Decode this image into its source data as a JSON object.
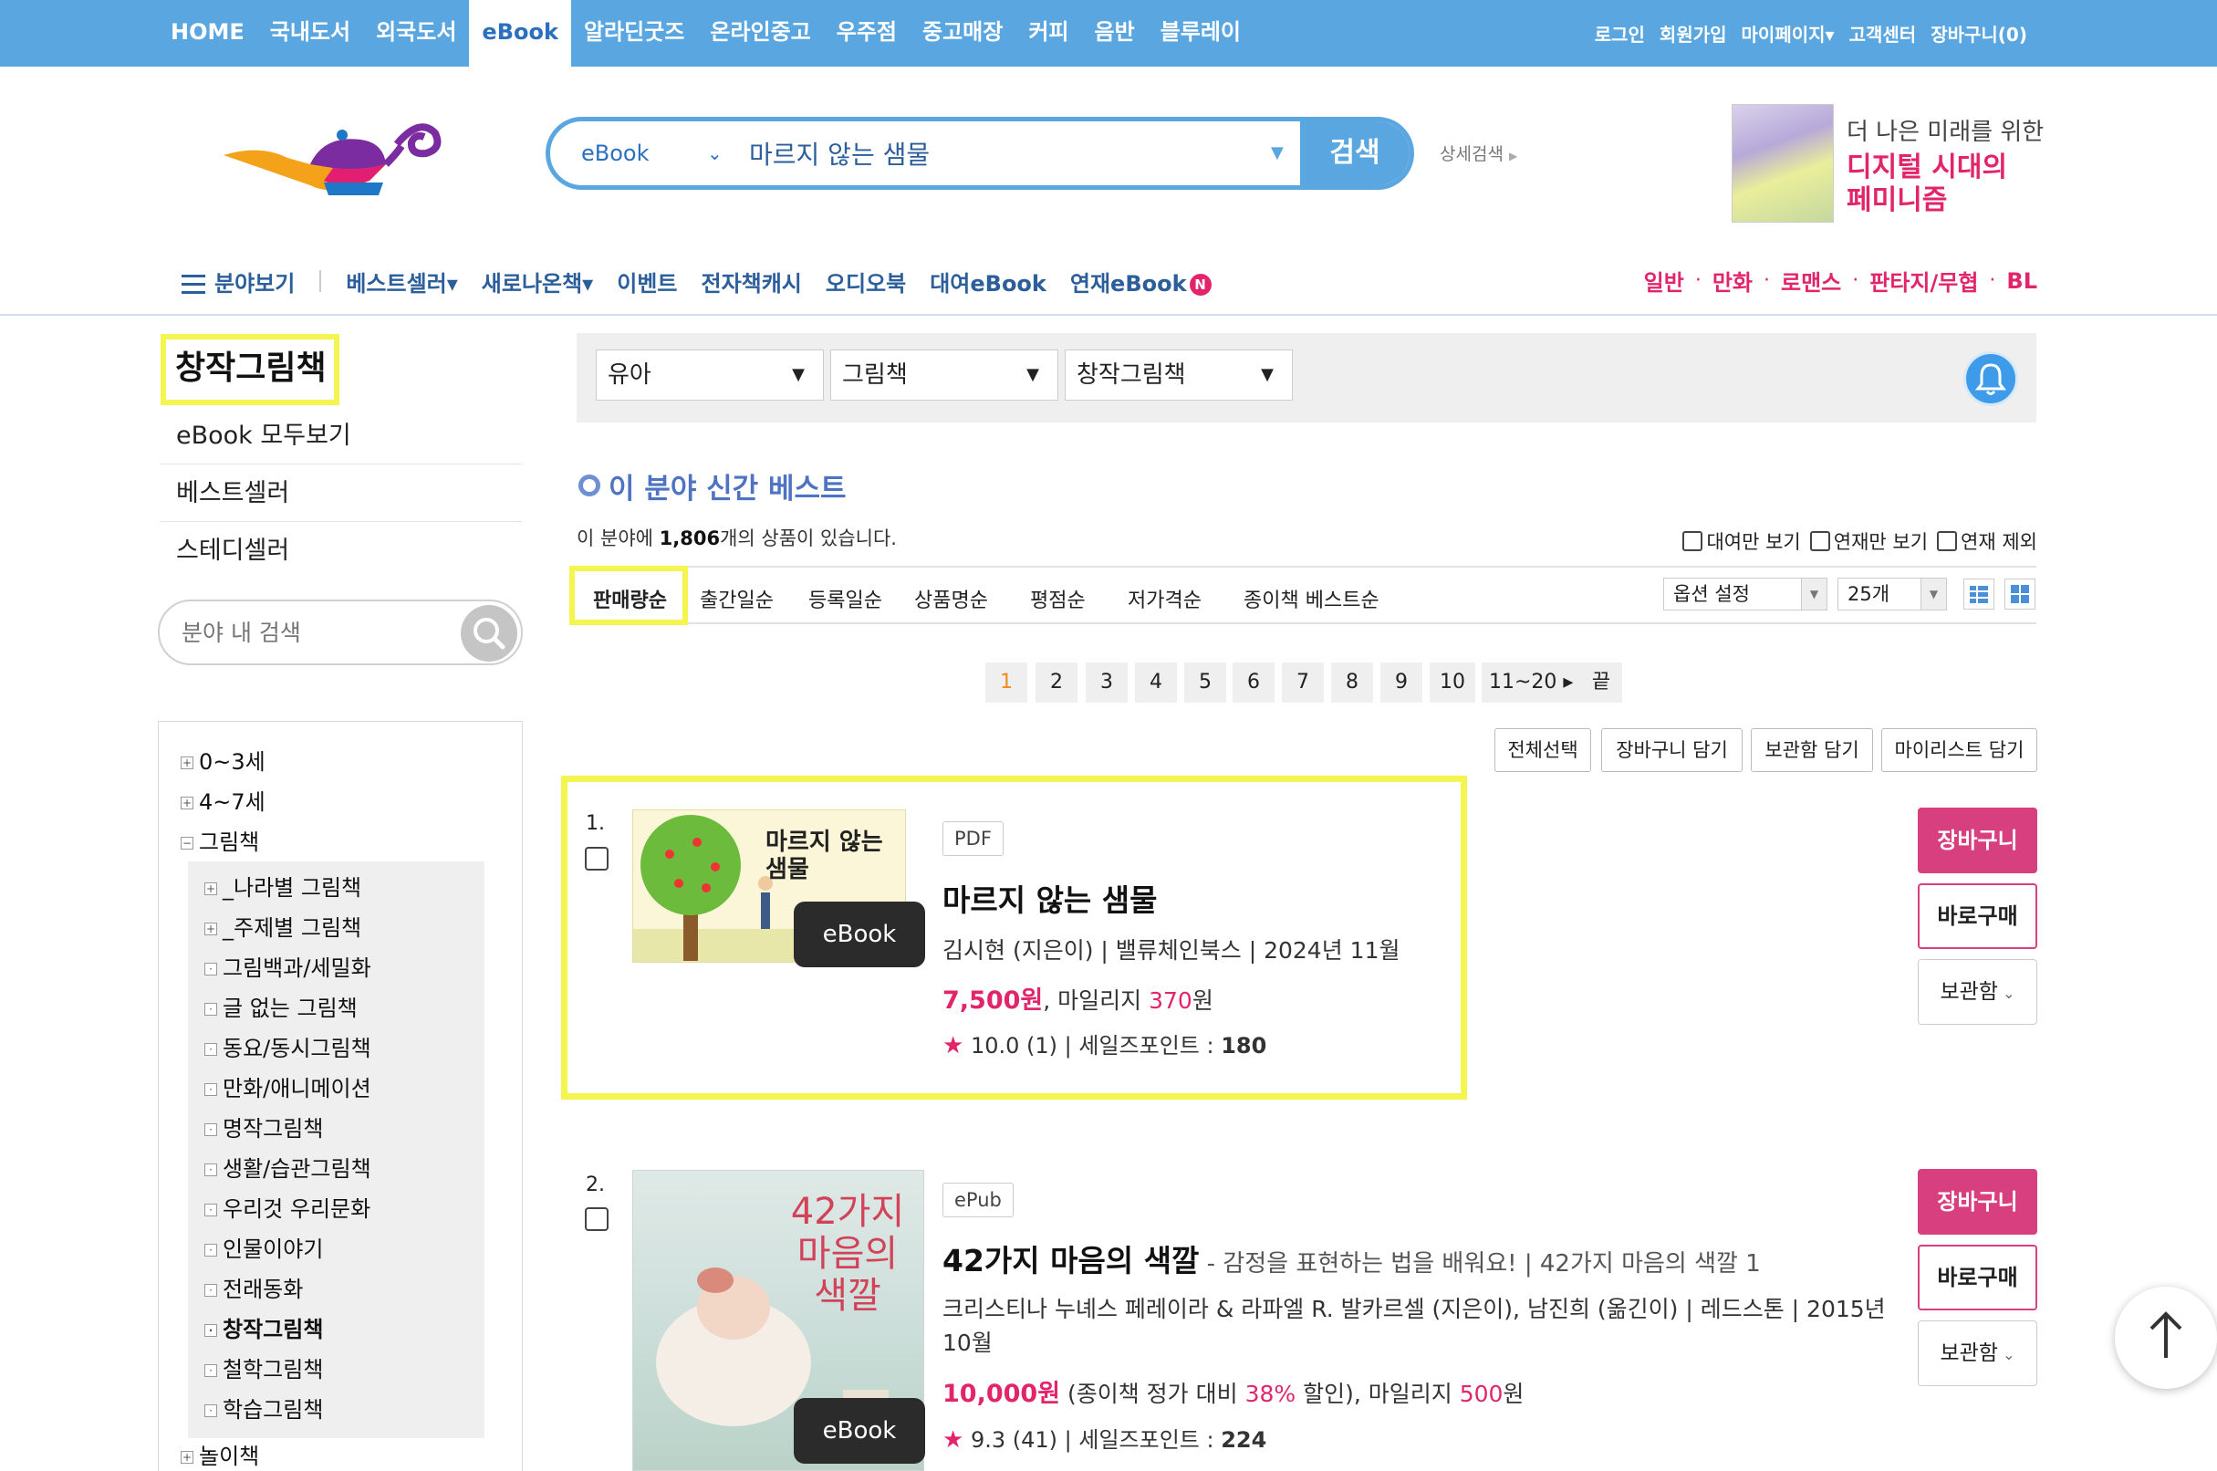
{
  "topnav": {
    "items": [
      {
        "label": "HOME",
        "active": false
      },
      {
        "label": "국내도서",
        "active": false
      },
      {
        "label": "외국도서",
        "active": false
      },
      {
        "label": "eBook",
        "active": true
      },
      {
        "label": "알라딘굿즈",
        "active": false
      },
      {
        "label": "온라인중고",
        "active": false
      },
      {
        "label": "우주점",
        "active": false
      },
      {
        "label": "중고매장",
        "active": false
      },
      {
        "label": "커피",
        "active": false
      },
      {
        "label": "음반",
        "active": false
      },
      {
        "label": "블루레이",
        "active": false
      }
    ],
    "right": [
      "로그인",
      "회원가입",
      "마이페이지▾",
      "고객센터",
      "장바구니(0)"
    ]
  },
  "search": {
    "category": "eBook",
    "query": "마르지 않는 샘물",
    "button": "검색",
    "advanced": "상세검색"
  },
  "promo": {
    "line1": "더 나은 미래를 위한",
    "line2": "디지털 시대의",
    "line3": "페미니즘"
  },
  "nav2": {
    "menu_label": "분야보기",
    "items": [
      "베스트셀러▾",
      "새로나온책▾",
      "이벤트",
      "전자책캐시",
      "오디오북",
      "대여eBook",
      "연재eBook"
    ],
    "badge": "N",
    "genres": [
      "일반",
      "만화",
      "로맨스",
      "판타지/무협",
      "BL"
    ]
  },
  "sidebar": {
    "title": "창작그림책",
    "links": [
      "eBook 모두보기",
      "베스트셀러",
      "스테디셀러"
    ],
    "search_placeholder": "분야 내 검색",
    "tree": [
      {
        "label": "0~3세",
        "mark": "+"
      },
      {
        "label": "4~7세",
        "mark": "+"
      },
      {
        "label": "그림책",
        "mark": "−"
      }
    ],
    "subtree": [
      {
        "label": "_나라별 그림책",
        "mark": "+"
      },
      {
        "label": "_주제별 그림책",
        "mark": "+"
      },
      {
        "label": "그림백과/세밀화",
        "mark": "·"
      },
      {
        "label": "글 없는 그림책",
        "mark": "·"
      },
      {
        "label": "동요/동시그림책",
        "mark": "·"
      },
      {
        "label": "만화/애니메이션",
        "mark": "·"
      },
      {
        "label": "명작그림책",
        "mark": "·"
      },
      {
        "label": "생활/습관그림책",
        "mark": "·"
      },
      {
        "label": "우리것 우리문화",
        "mark": "·"
      },
      {
        "label": "인물이야기",
        "mark": "·"
      },
      {
        "label": "전래동화",
        "mark": "·"
      },
      {
        "label": "창작그림책",
        "mark": "·",
        "current": true
      },
      {
        "label": "철학그림책",
        "mark": "·"
      },
      {
        "label": "학습그림책",
        "mark": "·"
      }
    ],
    "tree_after": {
      "label": "놀이책",
      "mark": "+"
    }
  },
  "filters": {
    "level1": "유아",
    "level2": "그림책",
    "level3": "창작그림책"
  },
  "section": {
    "title": "이 분야 신간 베스트",
    "count_prefix": "이 분야에 ",
    "count": "1,806",
    "count_suffix": "개의 상품이 있습니다.",
    "options": [
      "대여만 보기",
      "연재만 보기",
      "연재 제외"
    ]
  },
  "sort": {
    "items": [
      "판매량순",
      "출간일순",
      "등록일순",
      "상품명순",
      "평점순",
      "저가격순",
      "종이책 베스트순"
    ],
    "option_select": "옵션 설정",
    "page_size": "25개"
  },
  "pagination": [
    "1",
    "2",
    "3",
    "4",
    "5",
    "6",
    "7",
    "8",
    "9",
    "10",
    "11~20 ▸",
    "끝"
  ],
  "actions": [
    "전체선택",
    "장바구니 담기",
    "보관함 담기",
    "마이리스트 담기"
  ],
  "items": [
    {
      "no": "1.",
      "format": "PDF",
      "title": "마르지 않는 샘물",
      "subtitle": "",
      "author_line": "김시현 (지은이) | 밸류체인북스 | 2024년 11월",
      "price": "7,500원",
      "price_note": "",
      "mileage_label": ", 마일리지 ",
      "mileage": "370",
      "mileage_unit": "원",
      "rating": "10.0",
      "rating_count": "(1)",
      "sales_label": "| 세일즈포인트 : ",
      "sales_point": "180",
      "cover_title": "마르지 않는 샘물",
      "ebook_tag": "eBook",
      "btn_cart": "장바구니",
      "btn_buy": "바로구매",
      "btn_keep": "보관함"
    },
    {
      "no": "2.",
      "format": "ePub",
      "title": "42가지 마음의 색깔",
      "subtitle": " - 감정을 표현하는 법을 배워요!  |  42가지 마음의 색깔 1",
      "author_line": "크리스티나 누녜스 페레이라 & 라파엘 R. 발카르셀 (지은이), 남진희 (옮긴이) | 레드스톤 | 2015년 10월",
      "price": "10,000원",
      "price_note_pre": " (종이책 정가 대비 ",
      "discount": "38%",
      "price_note_post": " 할인)",
      "mileage_label": ", 마일리지 ",
      "mileage": "500",
      "mileage_unit": "원",
      "rating": "9.3",
      "rating_count": "(41)",
      "sales_label": "| 세일즈포인트 : ",
      "sales_point": "224",
      "cover_title": "42가지 마음의 색깔",
      "ebook_tag": "eBook",
      "btn_cart": "장바구니",
      "btn_buy": "바로구매",
      "btn_keep": "보관함"
    }
  ],
  "colors": {
    "brand_blue": "#5aa6e0",
    "accent_pink": "#e2256a",
    "highlight_yellow": "#f5f550"
  }
}
